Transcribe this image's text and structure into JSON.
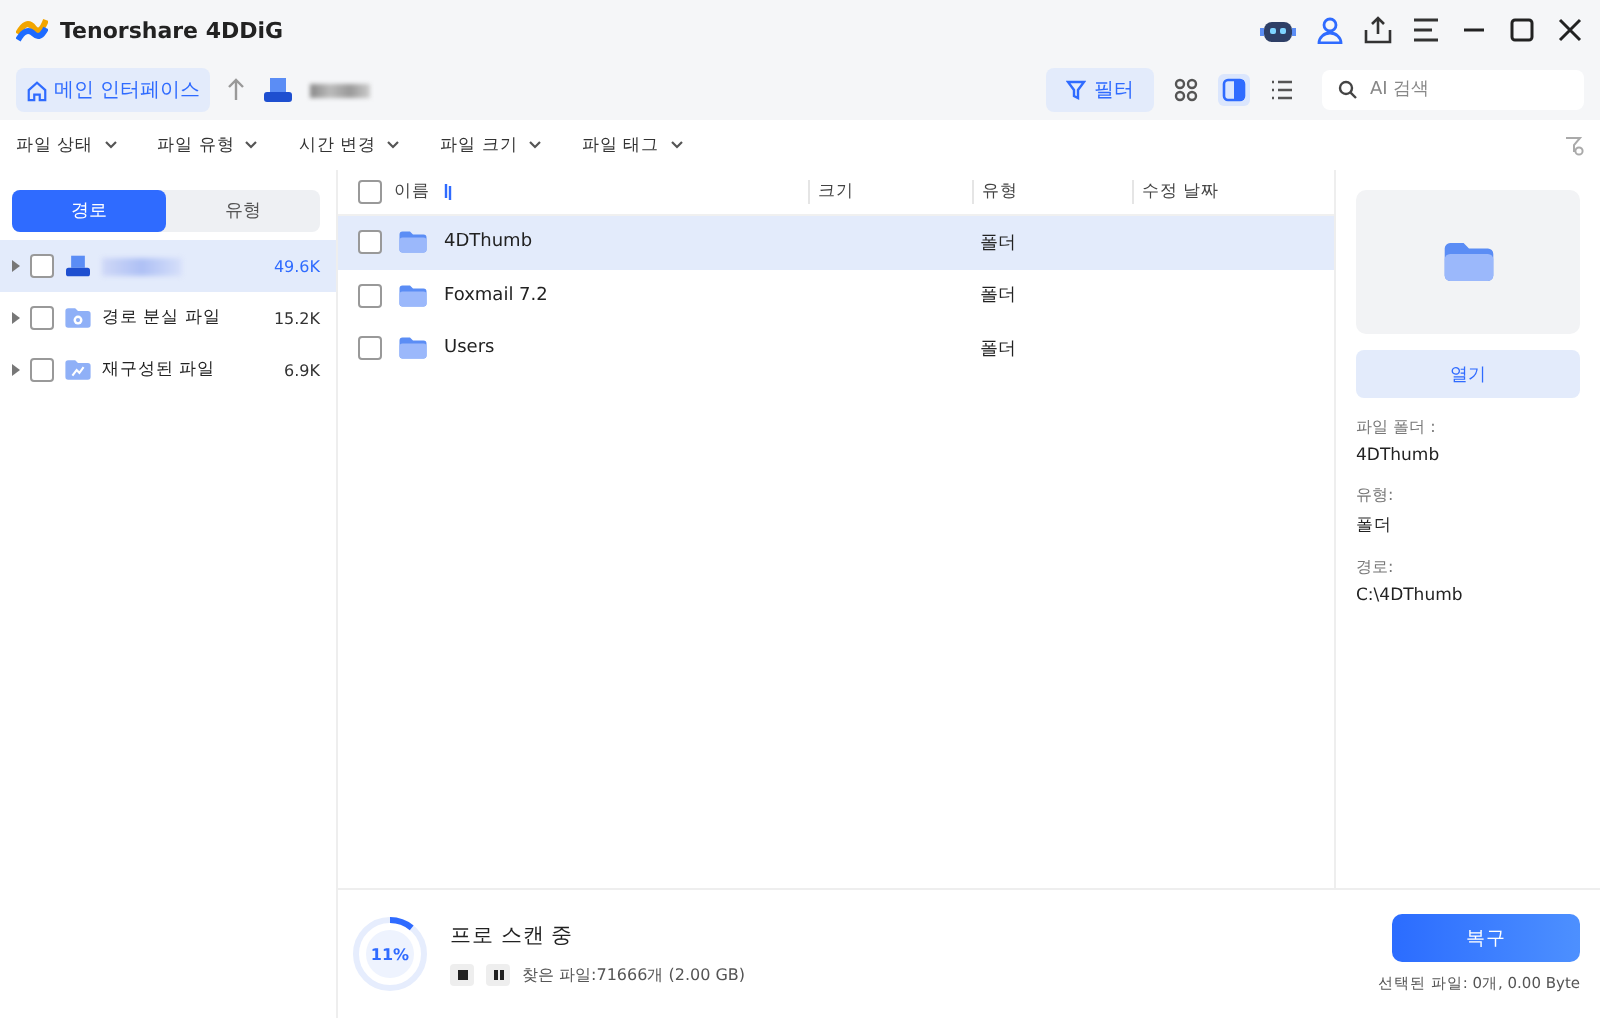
{
  "window": {
    "title": "Tenorshare 4DDiG"
  },
  "toolbar": {
    "home": {
      "label": "메인 인터페이스",
      "selected": true
    },
    "filter": {
      "label": "필터"
    },
    "views": [
      {
        "kind": "grid",
        "selected": false
      },
      {
        "kind": "panel",
        "selected": true
      },
      {
        "kind": "list",
        "selected": false
      }
    ],
    "search": {
      "placeholder": "AI 검색"
    }
  },
  "filters": [
    "파일 상태",
    "파일 유형",
    "시간 변경",
    "파일 크기",
    "파일 태그"
  ],
  "sidebar": {
    "tabs": [
      {
        "label": "경로",
        "selected": true
      },
      {
        "label": "유형",
        "selected": false
      }
    ],
    "items": [
      {
        "kind": "drive",
        "count": "49.6K",
        "selected": true,
        "checked": false
      },
      {
        "kind": "lost",
        "name": "경로 분실 파일",
        "count": "15.2K",
        "selected": false,
        "checked": false
      },
      {
        "kind": "rebuilt",
        "name": "재구성된 파일",
        "count": "6.9K",
        "selected": false,
        "checked": false
      }
    ]
  },
  "table": {
    "select_all": {
      "checked": false
    },
    "columns": [
      "이름",
      "크기",
      "유형",
      "수정 날짜"
    ],
    "rows": [
      {
        "name": "4DThumb",
        "type": "폴더",
        "selected": true,
        "checked": false
      },
      {
        "name": "Foxmail 7.2",
        "type": "폴더",
        "selected": false,
        "checked": false
      },
      {
        "name": "Users",
        "type": "폴더",
        "selected": false,
        "checked": false
      }
    ]
  },
  "details": {
    "open_button": "열기",
    "fields": [
      {
        "label": "파일 폴더 :",
        "value": "4DThumb"
      },
      {
        "label": "유형:",
        "value": "폴더"
      },
      {
        "label": "경로:",
        "value": "C:\\4DThumb"
      }
    ]
  },
  "scan": {
    "level": 0.11,
    "percent": "11%",
    "title": "프로 스캔 중",
    "found": "찾은 파일:71666개 (2.00 GB)"
  },
  "recover": {
    "label": "복구",
    "selected_info": "선택된 파일: 0개, 0.00 Byte"
  }
}
